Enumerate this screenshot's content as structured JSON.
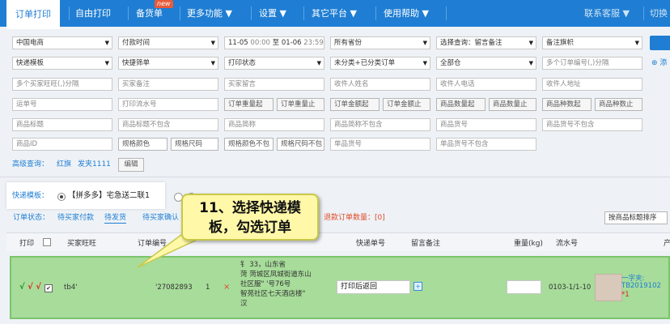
{
  "nav": {
    "items": [
      {
        "label": "订单打印"
      },
      {
        "label": "自由打印"
      },
      {
        "label": "备货单"
      },
      {
        "label": "更多功能 ▼"
      },
      {
        "label": "设置 ▼"
      },
      {
        "label": "其它平台 ▼"
      },
      {
        "label": "使用帮助 ▼"
      }
    ],
    "badge": "new",
    "contact": "联系客服 ▼",
    "switch": "切换"
  },
  "filters": {
    "row1": {
      "platform": "中国电商",
      "time_type": "付款时间",
      "date_from": "11-05",
      "time_from": "00:00",
      "date_to_label": "至",
      "date_to": "01-06",
      "time_to": "23:59",
      "province": "所有省份",
      "query_select": "选择查询：留言备注",
      "flag_select": "备注旗帜"
    },
    "row2": {
      "express_template": "快递模板",
      "quick_filter": "快捷筛单",
      "print_status": "打印状态",
      "order_type": "未分类+已分类订单",
      "all_parts": "全部仓",
      "order_ids_placeholder": "多个订单编号(,)分隔",
      "add": "添"
    },
    "row3": [
      "多个买家旺旺(,)分隔",
      "买家备注",
      "买家留言",
      "收件人姓名",
      "收件人电话",
      "收件人地址"
    ],
    "row4": [
      "运单号",
      "打印流水号",
      "订单重量起",
      "订单重量止",
      "订单金额起",
      "订单金额止",
      "商品数量起",
      "商品数量止",
      "商品种数起",
      "商品种数止"
    ],
    "row5": [
      "商品标题",
      "商品标题不包含",
      "商品简称",
      "商品简称不包含",
      "商品货号",
      "商品货号不包含"
    ],
    "row6": [
      "商品ID",
      "规格颜色",
      "规格尺码",
      "规格颜色不包",
      "规格尺码不包",
      "单品货号",
      "单品货号不包含"
    ],
    "advanced_label": "高级查询：",
    "advanced_tags": [
      "红旗",
      "发夹1111"
    ],
    "edit_button": "编辑"
  },
  "template": {
    "label": "快递模板：",
    "value": "【拼多多】宅急送二联1"
  },
  "status_bar": {
    "label": "订单状态：",
    "tabs": [
      "待买家付款",
      "待发货",
      "待买家确认"
    ],
    "refund_label": "退款订单数量：",
    "refund_count": "[0]",
    "sort_button": "按商品标题排序"
  },
  "callout": {
    "line1": "11、选择快递模",
    "line2": "板，勾选订单"
  },
  "table": {
    "headers": {
      "print": "打印",
      "buyer": "买家旺旺",
      "order_no": "订单编号",
      "tracking": "快递单号",
      "note": "留言备注",
      "weight": "重量(kg)",
      "serial": "流水号",
      "product": "产"
    },
    "row": {
      "marks": "√ √",
      "buyer": "tb4'",
      "order_no": "'27082893",
      "qty": "1",
      "delete_mark": "×",
      "address_lines": [
        "钅                    33，山东省",
        "菏        菏城区凤城街道东山",
        "社区服\"          '号76号",
        "智苑社区七天酒店楼\"",
        "汉"
      ],
      "tracking_value": "打印后返回",
      "serial": "0103-1/1-10",
      "product_title": "一字夹:",
      "product_code": "TB2019102",
      "product_qty": "*1"
    }
  }
}
